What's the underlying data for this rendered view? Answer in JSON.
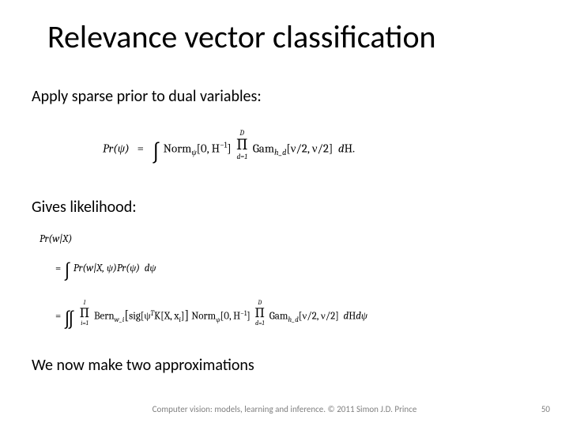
{
  "title": "Relevance vector classification",
  "body": {
    "line1": "Apply sparse prior to dual variables:",
    "line2": "Gives likelihood:",
    "line3": "We now make two approximations"
  },
  "eq1": {
    "lhs": "Pr(ψ)",
    "eq": "=",
    "norm": "Norm",
    "norm_sub": "ψ",
    "norm_arg": "[0, H",
    "norm_sup": "−1",
    "norm_close": "]",
    "prod_top": "D",
    "prod_bot": "d=1",
    "gam": "Gam",
    "gam_sub": "h_d",
    "gam_arg": "[ν/2, ν/2]",
    "dH_d": "d",
    "dH": "H."
  },
  "eq2": {
    "lhs": "Pr(w|X)",
    "a": {
      "eq": "=",
      "pr": "Pr(w|X, ψ)Pr(ψ)",
      "dpsi_d": "d",
      "dpsi": "ψ"
    },
    "b": {
      "eq": "=",
      "prod1_top": "I",
      "prod1_bot": "i=1",
      "bern": "Bern",
      "bern_sub": "w_i",
      "sig": "sig[ψ",
      "sig_sup": "T",
      "K": "K[X, x",
      "K_sub": "i",
      "K_close": "]",
      "norm": "Norm",
      "norm_sub": "ψ",
      "norm_arg": "[0, H",
      "norm_sup": "−1",
      "norm_close": "]",
      "prod2_top": "D",
      "prod2_bot": "d=1",
      "gam": "Gam",
      "gam_sub": "h_d",
      "gam_arg": "[ν/2, ν/2]",
      "dHdpsi_d1": "d",
      "dHdpsi_H": "H",
      "dHdpsi_d2": "d",
      "dHdpsi_psi": "ψ"
    }
  },
  "footer": "Computer vision: models, learning and inference.   © 2011 Simon J.D. Prince",
  "pagenum": "50"
}
